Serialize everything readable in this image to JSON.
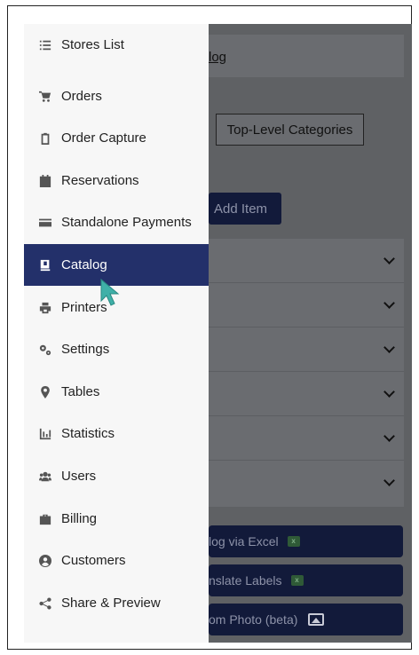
{
  "background": {
    "header_title": "log",
    "tabs": {
      "top_level_categories": "Top-Level Categories"
    },
    "add_item_label": "Add Item",
    "actions": [
      {
        "label": "log via Excel",
        "icon": "excel-icon"
      },
      {
        "label": "nslate Labels",
        "icon": "excel-icon"
      },
      {
        "label": "om Photo (beta)",
        "icon": "image-icon"
      }
    ]
  },
  "drawer": {
    "items": [
      {
        "label": "Stores List",
        "icon": "list-icon"
      },
      {
        "label": "Orders",
        "icon": "cart-icon"
      },
      {
        "label": "Order Capture",
        "icon": "clipboard-icon"
      },
      {
        "label": "Reservations",
        "icon": "calendar-icon"
      },
      {
        "label": "Standalone Payments",
        "icon": "credit-card-icon"
      },
      {
        "label": "Catalog",
        "icon": "book-icon",
        "active": true
      },
      {
        "label": "Printers",
        "icon": "printer-icon"
      },
      {
        "label": "Settings",
        "icon": "cogs-icon"
      },
      {
        "label": "Tables",
        "icon": "map-marker-icon"
      },
      {
        "label": "Statistics",
        "icon": "bar-chart-icon"
      },
      {
        "label": "Users",
        "icon": "users-icon"
      },
      {
        "label": "Billing",
        "icon": "briefcase-icon"
      },
      {
        "label": "Customers",
        "icon": "user-circle-icon"
      },
      {
        "label": "Share & Preview",
        "icon": "share-icon"
      }
    ]
  },
  "colors": {
    "active_bg": "#23306a",
    "overlay": "#5f6164",
    "drawer_bg": "#f7f7f7",
    "cursor": "#3fb0a8"
  }
}
